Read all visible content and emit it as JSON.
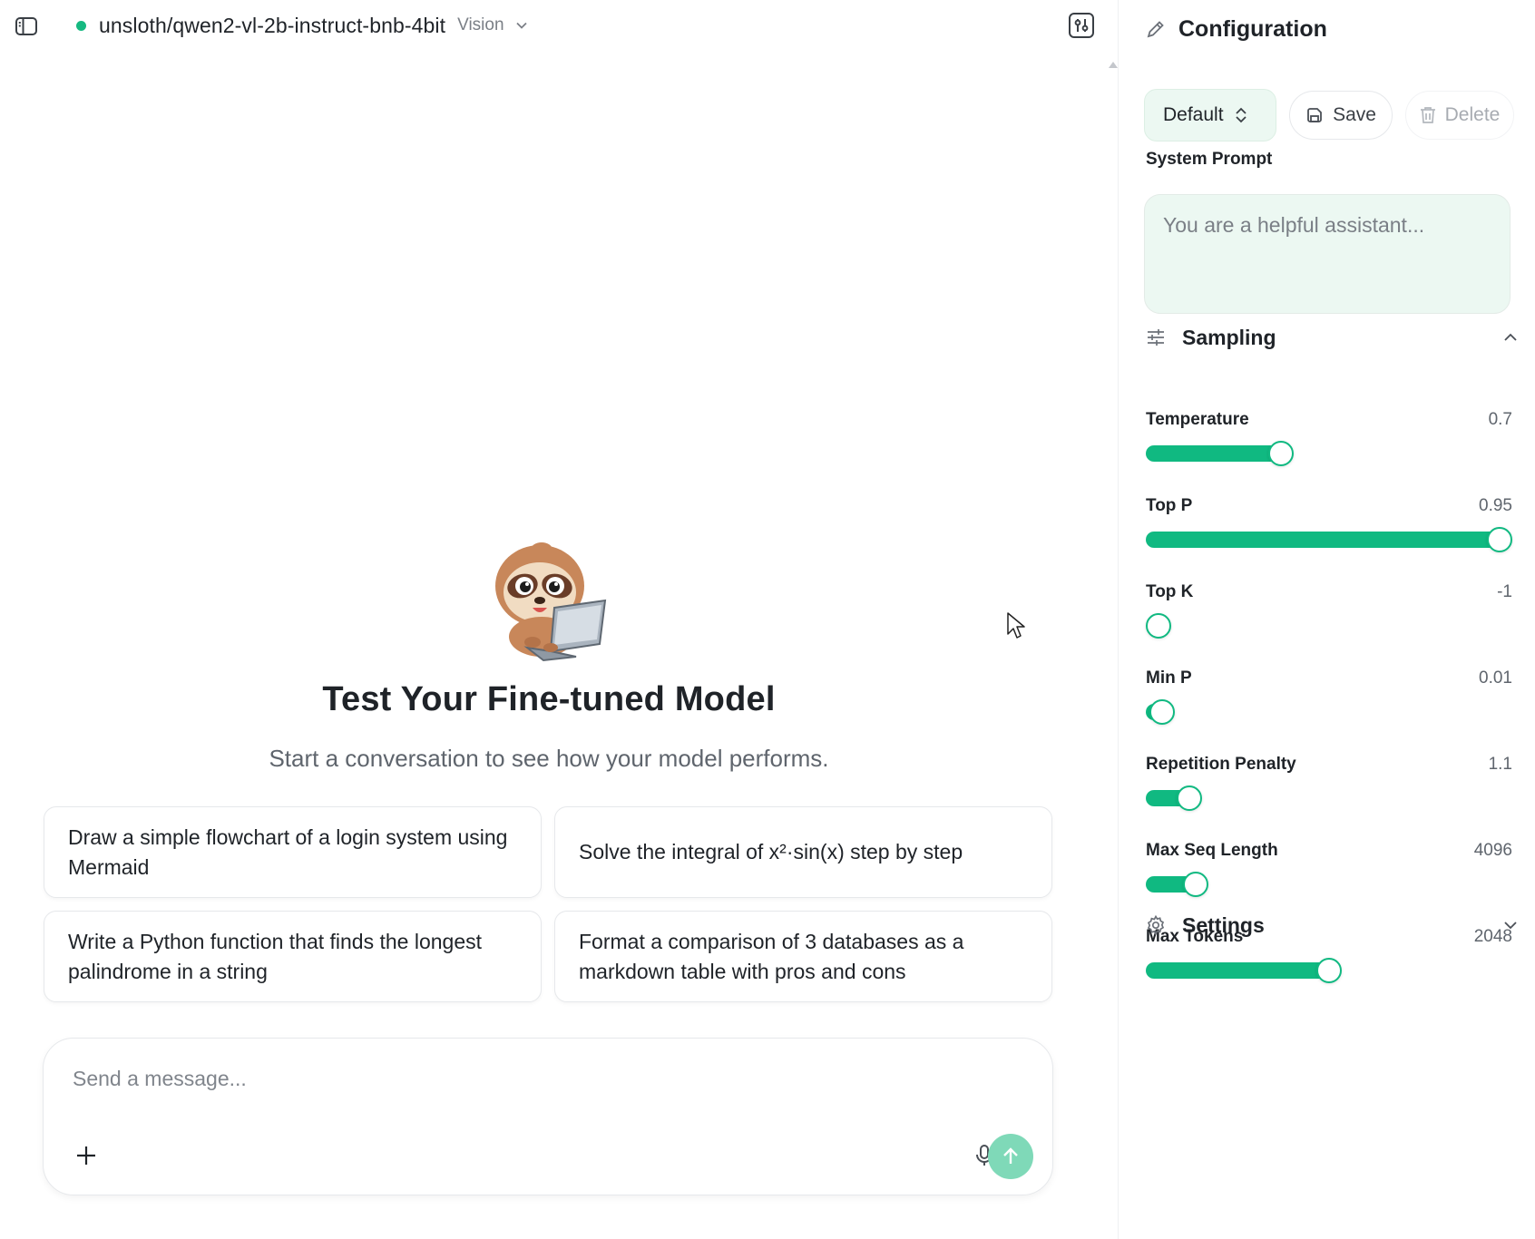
{
  "header": {
    "model_name": "unsloth/qwen2-vl-2b-instruct-bnb-4bit",
    "model_tag": "Vision",
    "status_color": "#16b981"
  },
  "welcome": {
    "title": "Test Your Fine-tuned Model",
    "subtitle": "Start a conversation to see how your model performs."
  },
  "suggestions": [
    "Draw a simple flowchart of a login system using Mermaid",
    "Solve the integral of x²·sin(x) step by step",
    "Write a Python function that finds the longest palindrome in a string",
    "Format a comparison of 3 databases as a markdown table with pros and cons"
  ],
  "composer": {
    "placeholder": "Send a message...",
    "send_color": "#7fd9b8"
  },
  "panel": {
    "title": "Configuration",
    "preset": "Default",
    "save_label": "Save",
    "delete_label": "Delete",
    "system_prompt_label": "System Prompt",
    "system_prompt_placeholder": "You are a helpful assistant...",
    "sampling": {
      "title": "Sampling",
      "expanded": true,
      "accent": "#10b981",
      "params": [
        {
          "key": "temperature",
          "label": "Temperature",
          "value": "0.7",
          "fraction": 0.36
        },
        {
          "key": "top-p",
          "label": "Top P",
          "value": "0.95",
          "fraction": 1.0
        },
        {
          "key": "top-k",
          "label": "Top K",
          "value": "-1",
          "fraction": 0.0
        },
        {
          "key": "min-p",
          "label": "Min P",
          "value": "0.01",
          "fraction": 0.01
        },
        {
          "key": "repetition-penalty",
          "label": "Repetition Penalty",
          "value": "1.1",
          "fraction": 0.09
        },
        {
          "key": "max-seq-length",
          "label": "Max Seq Length",
          "value": "4096",
          "fraction": 0.11
        },
        {
          "key": "max-tokens",
          "label": "Max Tokens",
          "value": "2048",
          "fraction": 0.5
        }
      ]
    },
    "settings": {
      "title": "Settings",
      "expanded": false
    }
  }
}
